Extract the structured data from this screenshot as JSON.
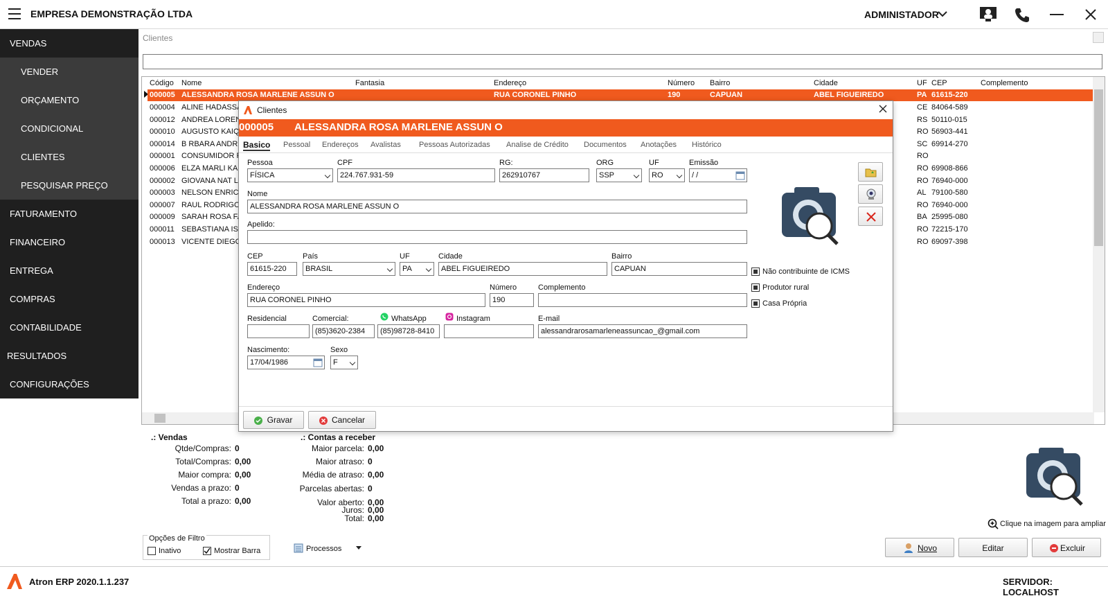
{
  "topbar": {
    "company": "EMPRESA DEMONSTRAÇÃO LTDA",
    "user": "ADMINISTADOR"
  },
  "sidebar": {
    "items": [
      {
        "label": "VENDAS"
      },
      {
        "label": "VENDER"
      },
      {
        "label": "ORÇAMENTO"
      },
      {
        "label": "CONDICIONAL"
      },
      {
        "label": "CLIENTES"
      },
      {
        "label": "PESQUISAR PREÇO"
      },
      {
        "label": "FATURAMENTO"
      },
      {
        "label": "FINANCEIRO"
      },
      {
        "label": "ENTREGA"
      },
      {
        "label": "COMPRAS"
      },
      {
        "label": "CONTABILIDADE"
      },
      {
        "label": "RESULTADOS"
      },
      {
        "label": "CONFIGURAÇÕES"
      }
    ]
  },
  "page": {
    "title": "Clientes",
    "search_value": ""
  },
  "grid": {
    "columns": [
      "Código",
      "Nome",
      "Fantasia",
      "Endereço",
      "Número",
      "Bairro",
      "Cidade",
      "UF",
      "CEP",
      "Complemento"
    ],
    "rows": [
      [
        "000005",
        "ALESSANDRA ROSA MARLENE ASSUN  O",
        "",
        "RUA CORONEL PINHO",
        "190",
        "CAPUAN",
        "ABEL FIGUEIREDO",
        "PA",
        "61615-220",
        ""
      ],
      [
        "000004",
        "ALINE HADASSA",
        "",
        "",
        "",
        "",
        "",
        "CE",
        "84064-589",
        ""
      ],
      [
        "000012",
        "ANDREA LOREN",
        "",
        "",
        "",
        "",
        "",
        "RS",
        "50110-015",
        ""
      ],
      [
        "000010",
        "AUGUSTO KAIQU",
        "",
        "",
        "",
        "",
        "",
        "RO",
        "56903-441",
        ""
      ],
      [
        "000014",
        "B RBARA ANDRE",
        "",
        "",
        "",
        "",
        "",
        "SC",
        "69914-270",
        ""
      ],
      [
        "000001",
        "CONSUMIDOR F",
        "",
        "",
        "",
        "",
        "",
        "RO",
        "",
        ""
      ],
      [
        "000006",
        "ELZA MARLI KAN",
        "",
        "",
        "",
        "",
        "",
        "RO",
        "69908-866",
        ""
      ],
      [
        "000002",
        "GIOVANA NAT L",
        "",
        "",
        "",
        "",
        "",
        "RO",
        "76940-000",
        ""
      ],
      [
        "000003",
        "NELSON ENRICO",
        "",
        "",
        "",
        "",
        "",
        "AL",
        "79100-580",
        ""
      ],
      [
        "000007",
        "RAUL RODRIGO",
        "",
        "",
        "",
        "",
        "",
        "RO",
        "76940-000",
        ""
      ],
      [
        "000009",
        "SARAH ROSA FA",
        "",
        "",
        "",
        "",
        "",
        "BA",
        "25995-080",
        ""
      ],
      [
        "000011",
        "SEBASTIANA ISI",
        "",
        "",
        "",
        "",
        "",
        "RO",
        "72215-170",
        ""
      ],
      [
        "000013",
        "VICENTE DIEGO",
        "",
        "",
        "",
        "",
        "",
        "RO",
        "69097-398",
        ""
      ]
    ]
  },
  "stats": {
    "vendas_title": ".: Vendas",
    "vendas": [
      {
        "label": "Qtde/Compras:",
        "value": "0"
      },
      {
        "label": "Total/Compras:",
        "value": "0,00"
      },
      {
        "label": "Maior compra:",
        "value": "0,00"
      },
      {
        "label": "Vendas a prazo:",
        "value": "0"
      },
      {
        "label": "Total a prazo:",
        "value": "0,00"
      }
    ],
    "contas_title": ".: Contas a receber",
    "contas": [
      {
        "label": "Maior parcela:",
        "value": "0,00"
      },
      {
        "label": "Maior atraso:",
        "value": "0"
      },
      {
        "label": "Média de atraso:",
        "value": "0,00"
      },
      {
        "label": "Parcelas abertas:",
        "value": "0"
      },
      {
        "label": "Valor aberto:",
        "value": "0,00"
      },
      {
        "label": "Juros:",
        "value": "0,00"
      },
      {
        "label": "Total:",
        "value": "0,00"
      }
    ],
    "zoom_hint": "Clique na imagem para ampliar"
  },
  "filters": {
    "title": "Opções de Filtro",
    "inativo": "Inativo",
    "mostrar_barra": "Mostrar Barra",
    "processos": "Processos"
  },
  "actions": {
    "novo": "Novo",
    "editar": "Editar",
    "excluir": "Excluir"
  },
  "statusbar": {
    "version": "Atron ERP 2020.1.1.237",
    "server": "SERVIDOR: LOCALHOST"
  },
  "dialog": {
    "title": "Clientes",
    "code": "000005",
    "name": "ALESSANDRA ROSA MARLENE ASSUN  O",
    "tabs": [
      "Basico",
      "Pessoal",
      "Endereços",
      "Avalistas",
      "Pessoas Autorizadas",
      "Analise de Crédito",
      "Documentos",
      "Anotações",
      "Histórico"
    ],
    "labels": {
      "pessoa": "Pessoa",
      "cpf": "CPF",
      "rg": "RG:",
      "org": "ORG",
      "uf": "UF",
      "emissao": "Emissão",
      "nome": "Nome",
      "apelido": "Apelido:",
      "cep": "CEP",
      "pais": "País",
      "uf2": "UF",
      "cidade": "Cidade",
      "bairro": "Bairro",
      "endereco": "Endereço",
      "numero": "Número",
      "complemento": "Complemento",
      "residencial": "Residencial",
      "comercial": "Comercial:",
      "whatsapp": "WhatsApp",
      "instagram": "Instagram",
      "email": "E-mail",
      "nascimento": "Nascimento:",
      "sexo": "Sexo"
    },
    "values": {
      "pessoa": "FÍSICA",
      "cpf": "224.767.931-59",
      "rg": "262910767",
      "org": "SSP",
      "uf": "RO",
      "emissao": " / /",
      "nome": "ALESSANDRA ROSA MARLENE ASSUN  O",
      "apelido": "",
      "cep": "61615-220",
      "pais": "BRASIL",
      "uf2": "PA",
      "cidade": "ABEL FIGUEIREDO",
      "bairro": "CAPUAN",
      "endereco": "RUA CORONEL PINHO",
      "numero": "190",
      "complemento": "",
      "residencial": "",
      "comercial": "(85)3620-2384",
      "whatsapp": "(85)98728-8410",
      "instagram": "",
      "email": "alessandrarosamarleneassuncao_@gmail.com",
      "nascimento": "17/04/1986",
      "sexo": "F"
    },
    "checks": {
      "icms": "Não contribuinte de ICMS",
      "rural": "Produtor rural",
      "casa": "Casa Própria"
    },
    "gravar": "Gravar",
    "cancelar": "Cancelar"
  }
}
